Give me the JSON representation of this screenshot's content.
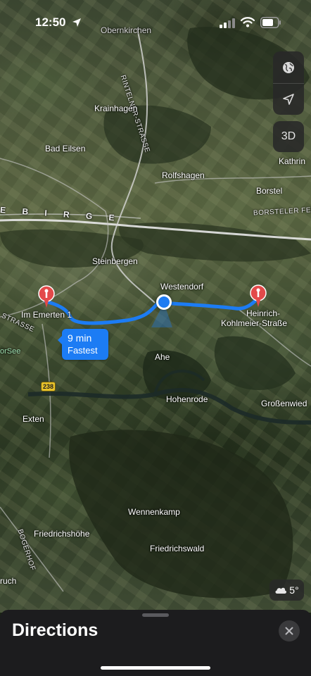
{
  "status_bar": {
    "time": "12:50",
    "icons": [
      "location-arrow-icon",
      "cellular-signal-icon",
      "wifi-icon",
      "battery-icon"
    ]
  },
  "map": {
    "labels": {
      "obernkirchen": "Obernkirchen",
      "rintelner_strasse": "RINTELNER-STRASSE",
      "krainhagen": "Krainhagen",
      "bad_eilsen": "Bad Eilsen",
      "rolfshagen": "Rolfshagen",
      "kathrin": "Kathrin",
      "borstel": "Borstel",
      "borsteler_feld": "BORSTELER FELD",
      "ridge": "E B I R G E",
      "steinbergen": "Steinbergen",
      "westendorf": "Westendorf",
      "strasse_left": "STRASSE",
      "or_see": "orSee",
      "ahe": "Ahe",
      "hohenrode": "Hohenrode",
      "grossenwied": "Großenwied",
      "exten": "Exten",
      "wennenkamp": "Wennenkamp",
      "friedrichshoehe": "Friedrichshöhe",
      "friedrichswald": "Friedrichswald",
      "bogerhof": "BOGERHOF",
      "ruch": "ruch"
    },
    "route_shield": "238",
    "start_pin_label": "Im Emerten 1",
    "end_pin_label_line1": "Heinrich-",
    "end_pin_label_line2": "Kohlmeier-Straße",
    "route_callout": {
      "duration": "9 min",
      "tag": "Fastest"
    },
    "weather": {
      "icon": "cloud-icon",
      "temperature": "5°"
    },
    "controls": {
      "map_type": "globe-icon",
      "locate": "location-arrow-icon",
      "view_3d": "3D"
    },
    "colors": {
      "route": "#1c7cf4",
      "pin": "#e34a4a",
      "user_dot": "#1e7cf2"
    }
  },
  "sheet": {
    "title": "Directions",
    "close_icon": "close-icon"
  }
}
